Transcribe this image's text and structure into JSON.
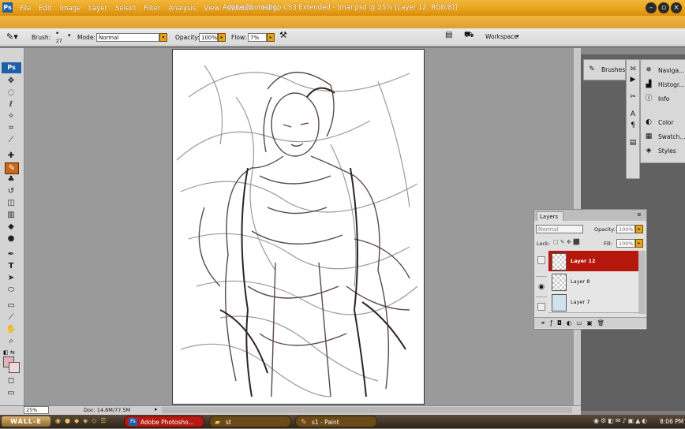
{
  "window": {
    "title": "Adobe Photoshop CS3 Extended - [mar.psd @ 25% (Layer 12, RGB/8)]",
    "app_badge": "Ps"
  },
  "menu": [
    "File",
    "Edit",
    "Image",
    "Layer",
    "Select",
    "Filter",
    "Analysis",
    "View",
    "Window",
    "Help"
  ],
  "options": {
    "brush_label": "Brush:",
    "brush_size": "27",
    "mode_label": "Mode:",
    "mode_value": "Normal",
    "opacity_label": "Opacity:",
    "opacity_value": "100%",
    "flow_label": "Flow:",
    "flow_value": "7%",
    "workspace_label": "Workspace"
  },
  "toolbox": {
    "badge": "Ps",
    "tools": [
      "move-tool",
      "marquee-tool",
      "lasso-tool",
      "magic-wand-tool",
      "crop-tool",
      "eyedropper-tool",
      "healing-brush-tool",
      "brush-tool",
      "clone-stamp-tool",
      "history-brush-tool",
      "eraser-tool",
      "gradient-tool",
      "blur-tool",
      "dodge-tool",
      "pen-tool",
      "type-tool",
      "path-selection-tool",
      "shape-tool",
      "notes-tool",
      "eyedropper2-tool",
      "hand-tool",
      "zoom-tool"
    ]
  },
  "dock": {
    "brushes": "Brushes",
    "panels_right": [
      "Naviga...",
      "Histogr...",
      "Info",
      "Color",
      "Swatch...",
      "Styles"
    ]
  },
  "layers_panel": {
    "tab": "Layers",
    "close": "×",
    "blend_mode": "Normal",
    "opacity_label": "Opacity:",
    "opacity_value": "100%",
    "lock_label": "Lock:",
    "fill_label": "Fill:",
    "fill_value": "100%",
    "layers": [
      {
        "name": "Layer 12",
        "selected": true,
        "visible": false
      },
      {
        "name": "Layer 8",
        "selected": false,
        "visible": true
      },
      {
        "name": "Layer 7",
        "selected": false,
        "visible": false
      }
    ]
  },
  "status": {
    "zoom": "25%",
    "doc": "Doc: 14.8M/77.5M"
  },
  "taskbar": {
    "start": "WALL-E",
    "tasks": [
      "Adobe Photosho...",
      "st",
      "s1 - Paint"
    ],
    "clock": "8:06 PM"
  },
  "colors": {
    "title_orange": "#e8a21b",
    "selected_layer": "#b5170d",
    "ps_blue": "#1f5fa8"
  }
}
